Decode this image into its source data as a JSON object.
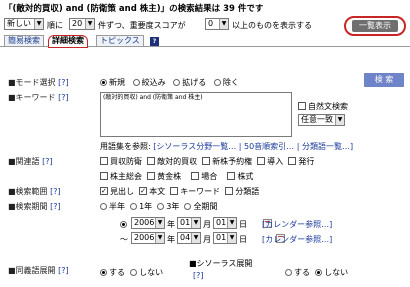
{
  "title": "「(敵対的買収) and (防衛策 and 株主)」の検索結果は 39 件です",
  "sort": {
    "order_value": "新しい",
    "order_suffix": "順に",
    "count_value": "20",
    "count_suffix": "件ずつ、重要度スコアが",
    "score_value": "0",
    "score_suffix": "以上のものを表示する",
    "list_button": "一覧表示"
  },
  "tabs": [
    "簡易検索",
    "詳細検索",
    "トピックス"
  ],
  "help_icon": "?",
  "mode": {
    "label": "■モード選択",
    "help": "[?]",
    "options": [
      "新規",
      "絞込み",
      "拡げる",
      "除く"
    ],
    "selected": "新規"
  },
  "search_button": "検 索",
  "keyword": {
    "label": "■キーワード",
    "help": "[?]",
    "value": "(敵対的買収) and (防衛策 and 株主)",
    "natural": "自然文検索",
    "match": "任意一致"
  },
  "glossary": {
    "prefix": "用語集を参照:",
    "link1": "[シソーラス分野一覧…",
    "link2": "| 50音順索引…",
    "link3": "| 分類語一覧…]"
  },
  "related": {
    "label": "■関連語",
    "help": "[?]",
    "row1": [
      "買収防衛",
      "敵対的買収",
      "新株予約権",
      "導入",
      "発行"
    ],
    "row2": [
      "株主総会",
      "黄金株",
      "場合",
      "株式"
    ]
  },
  "scope": {
    "label": "■検索範囲",
    "help": "[?]",
    "options": [
      "見出し",
      "本文",
      "キーワード",
      "分類語"
    ],
    "checked": [
      "見出し",
      "本文"
    ]
  },
  "period": {
    "label": "■検索期間",
    "help": "[?]",
    "options": [
      "半年",
      "1年",
      "3年",
      "全期間"
    ],
    "from": {
      "year": "2006",
      "month": "01",
      "day": "01"
    },
    "to": {
      "year": "2006",
      "month": "04",
      "day": "01"
    },
    "year_suffix": "年",
    "month_suffix": "月",
    "day_suffix": "日",
    "tilde": "〜",
    "calendar": "[カレンダー参照…]"
  },
  "synonym": {
    "label": "■同義語展開",
    "help": "[?]",
    "on": "する",
    "off": "しない",
    "selected": "する"
  },
  "thesaurus": {
    "label": "■シソーラス展開",
    "help": "[?]",
    "on": "する",
    "off": "しない",
    "selected": "しない"
  }
}
